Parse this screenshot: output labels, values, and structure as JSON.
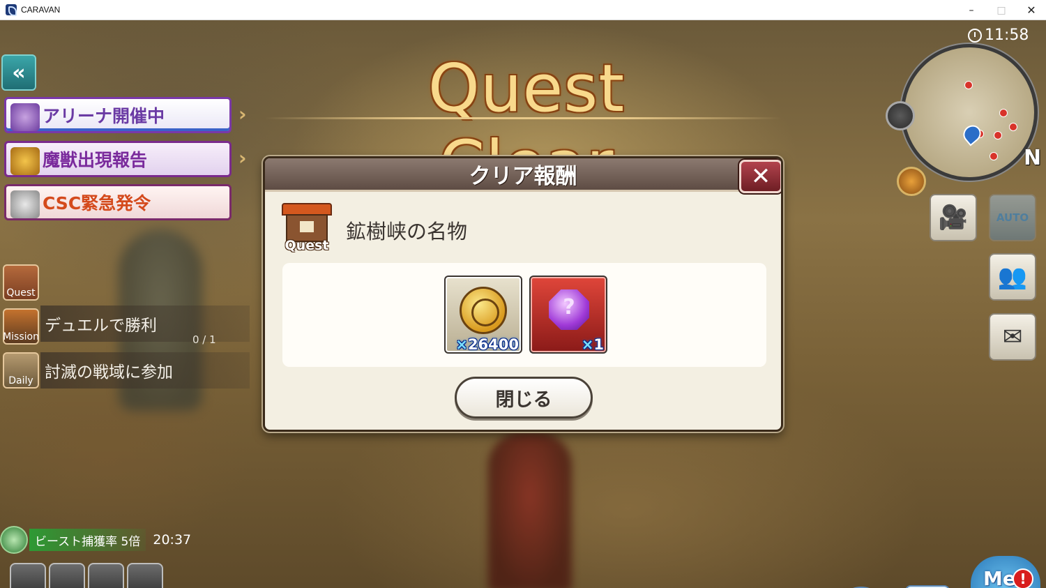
{
  "window": {
    "title": "CARAVAN",
    "minimize": "–",
    "maximize": "□",
    "close": "✕"
  },
  "hud": {
    "clock": "11:58",
    "compass_label": "N",
    "back_symbol": "«",
    "banner_arrow": "›"
  },
  "banners": [
    {
      "label": "アリーナ開催中"
    },
    {
      "label": "魔獣出現報告"
    },
    {
      "label": "CSC緊急発令"
    }
  ],
  "side_list": {
    "quest_tile": "Quest",
    "mission_tile": "Mission",
    "daily_tile": "Daily",
    "mission_text": "デュエルで勝利",
    "mission_progress": "0 / 1",
    "daily_text": "討滅の戦域に参加"
  },
  "buff": {
    "text": "ビースト捕獲率 5倍",
    "time": "20:37"
  },
  "right_buttons": {
    "auto_label": "AUTO"
  },
  "me_button": {
    "label": "Me",
    "badge": "!"
  },
  "chat_button": {
    "label": "···"
  },
  "screen_title": "Quest Clear",
  "dialog": {
    "header": "クリア報酬",
    "close_symbol": "✕",
    "quest_icon_label": "Quest",
    "quest_name": "鉱樹峡の名物",
    "rewards": [
      {
        "icon": "gold-coin-icon",
        "qty_prefix": "×",
        "qty": "26400"
      },
      {
        "icon": "purple-gem-icon",
        "qty_prefix": "×",
        "qty": "1"
      }
    ],
    "close_button": "閉じる"
  },
  "colors": {
    "accent_gold": "#f8d98c",
    "buff_green": "#2d9a34",
    "close_red": "#b2434d",
    "dialog_bg": "#f3efe2"
  }
}
